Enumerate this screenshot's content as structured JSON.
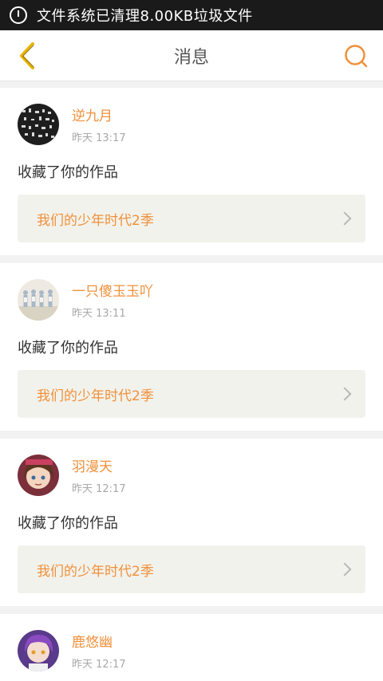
{
  "status_bar": {
    "text": "文件系统已清理8.00KB垃圾文件"
  },
  "header": {
    "title": "消息",
    "back_icon": "back-chevron-icon",
    "search_icon": "search-icon"
  },
  "colors": {
    "accent": "#f0903a",
    "back": "#e8b400"
  },
  "items": [
    {
      "username": "逆九月",
      "time": "昨天 13:17",
      "action": "收藏了你的作品",
      "work": "我们的少年时代2季"
    },
    {
      "username": "一只傻玉玉吖",
      "time": "昨天 13:11",
      "action": "收藏了你的作品",
      "work": "我们的少年时代2季"
    },
    {
      "username": "羽漫天",
      "time": "昨天 12:17",
      "action": "收藏了你的作品",
      "work": "我们的少年时代2季"
    },
    {
      "username": "鹿悠幽",
      "time": "昨天 12:17"
    }
  ]
}
